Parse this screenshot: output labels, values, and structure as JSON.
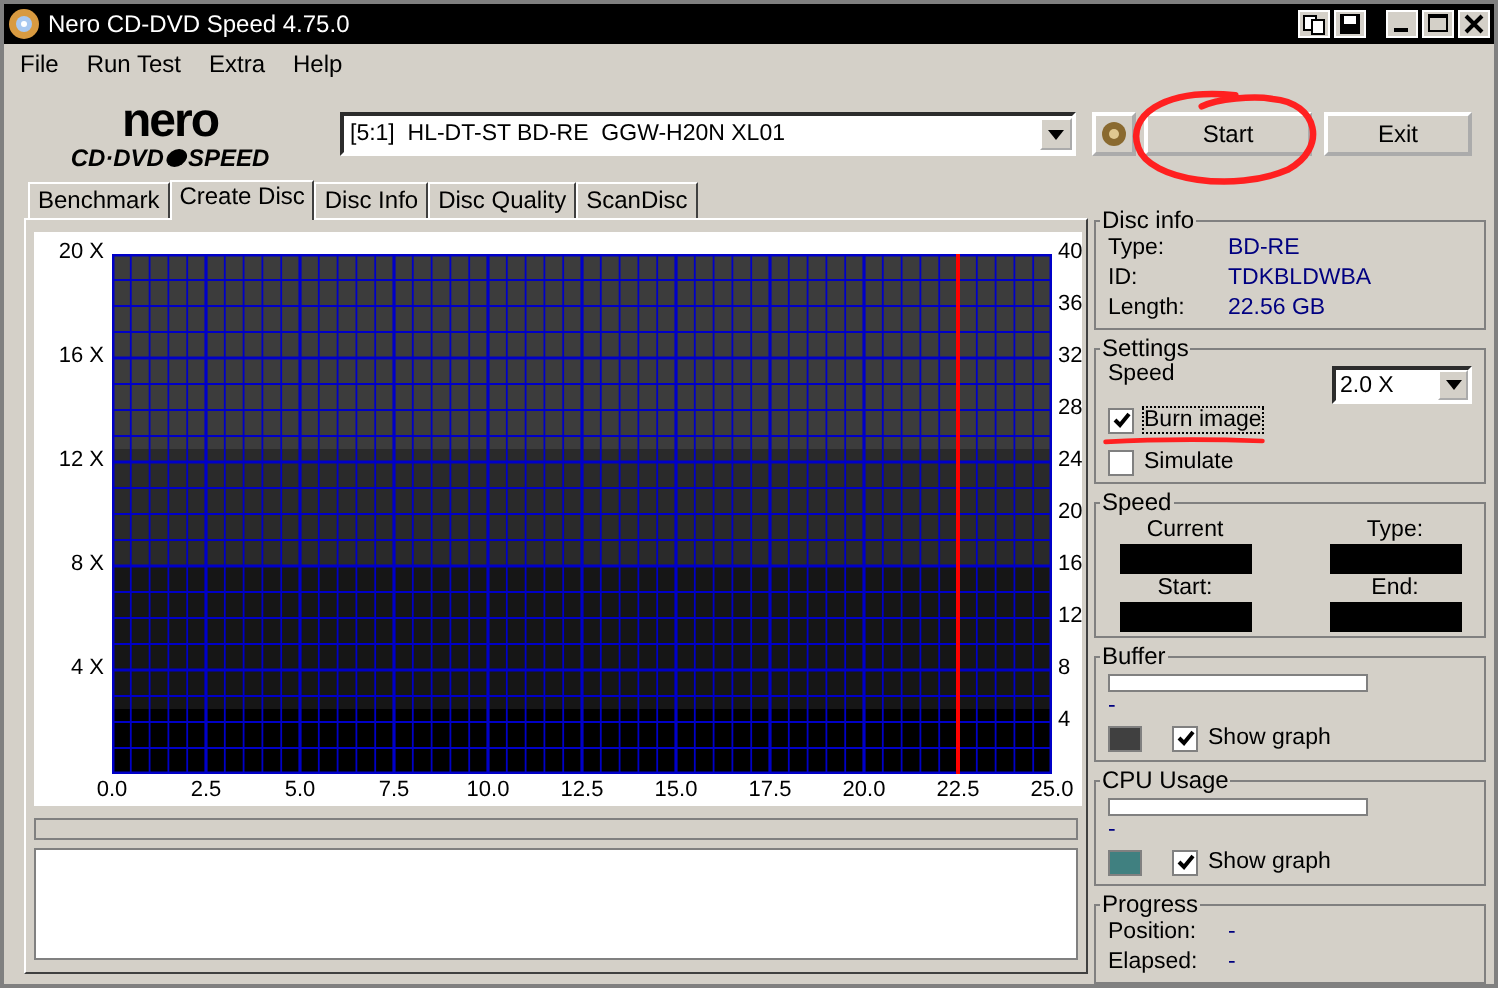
{
  "window": {
    "title": "Nero CD-DVD Speed 4.75.0"
  },
  "menu": [
    "File",
    "Run Test",
    "Extra",
    "Help"
  ],
  "logo": {
    "top": "nero",
    "bottom": "CD·DVD",
    "bottom_end": "SPEED"
  },
  "drive": {
    "value": "[5:1]  HL-DT-ST BD-RE  GGW-H20N XL01"
  },
  "buttons": [
    "Start",
    "Exit"
  ],
  "tabs": [
    {
      "label": "Benchmark",
      "selected": false
    },
    {
      "label": "Create Disc",
      "selected": true
    },
    {
      "label": "Disc Info",
      "selected": false
    },
    {
      "label": "Disc Quality",
      "selected": false
    },
    {
      "label": "ScanDisc",
      "selected": false
    }
  ],
  "chart": {
    "left_ticks": [
      "20 X",
      "16 X",
      "12 X",
      "8 X",
      "4 X"
    ],
    "right_ticks": [
      "40",
      "36",
      "32",
      "28",
      "24",
      "20",
      "16",
      "12",
      "8",
      "4"
    ],
    "x_ticks": [
      "0.0",
      "2.5",
      "5.0",
      "7.5",
      "10.0",
      "12.5",
      "15.0",
      "17.5",
      "20.0",
      "22.5",
      "25.0"
    ],
    "cursor": {
      "level": 0.9
    }
  },
  "progress": {
    "level": 0
  },
  "disc_info": {
    "title": "Disc info",
    "rows": [
      {
        "label": "Type:",
        "value": "BD-RE"
      },
      {
        "label": "ID:",
        "value": "TDKBLDWBA"
      },
      {
        "label": "Length:",
        "value": "22.56 GB"
      }
    ]
  },
  "settings": {
    "title": "Settings",
    "speed_label": "Speed",
    "speed_value": "2.0 X",
    "options": [
      {
        "label": "Burn image",
        "checked": true
      },
      {
        "label": "Simulate",
        "checked": false
      }
    ]
  },
  "speed": {
    "title": "Speed",
    "fields": [
      "Current",
      "Type:",
      "Start:",
      "End:"
    ]
  },
  "buffer": {
    "title": "Buffer",
    "level": 0,
    "reading": "-",
    "color": "#404040",
    "show_graph": {
      "label": "Show graph",
      "checked": true
    }
  },
  "cpu": {
    "title": "CPU Usage",
    "level": 0,
    "reading": "-",
    "color": "#408080",
    "show_graph": {
      "label": "Show graph",
      "checked": true
    }
  },
  "progress_info": {
    "title": "Progress",
    "rows": [
      {
        "label": "Position:",
        "value": "-"
      },
      {
        "label": "Elapsed:",
        "value": "-"
      }
    ]
  }
}
